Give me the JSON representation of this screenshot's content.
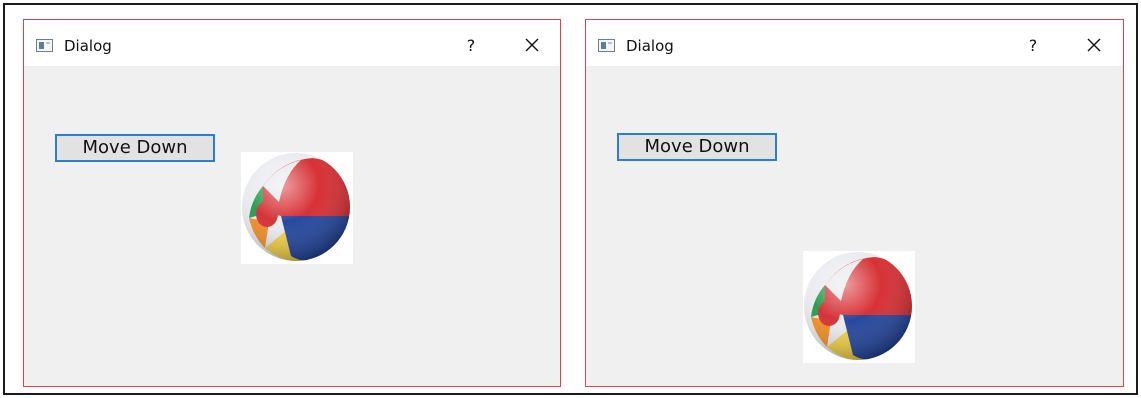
{
  "dialogs": [
    {
      "title": "Dialog",
      "help_label": "?",
      "button_label": "Move Down",
      "image": "beach-ball"
    },
    {
      "title": "Dialog",
      "help_label": "?",
      "button_label": "Move Down",
      "image": "beach-ball"
    }
  ],
  "colors": {
    "dialog_border": "#e0414b",
    "client_background": "#f0f0f0",
    "button_focus_border": "#2a7fd4"
  }
}
